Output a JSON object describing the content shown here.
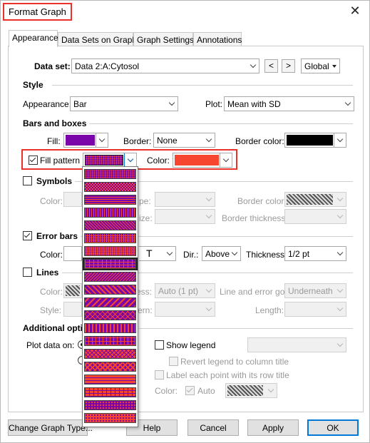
{
  "window": {
    "title": "Format Graph",
    "close_icon": "close-icon"
  },
  "tabs": [
    {
      "label": "Appearance",
      "active": true
    },
    {
      "label": "Data Sets on Graph"
    },
    {
      "label": "Graph Settings"
    },
    {
      "label": "Annotations"
    }
  ],
  "dataset": {
    "label": "Data set:",
    "value": "Data 2:A:Cytosol",
    "prev": "<",
    "next": ">",
    "scope": "Global"
  },
  "style": {
    "heading": "Style",
    "appearance_label": "Appearance:",
    "appearance_value": "Bar",
    "plot_label": "Plot:",
    "plot_value": "Mean with SD"
  },
  "bars": {
    "heading": "Bars and boxes",
    "fill_label": "Fill:",
    "fill_color": "#7a05a8",
    "border_label": "Border:",
    "border_value": "None",
    "border_color_label": "Border color:",
    "border_color": "#000000",
    "fill_pattern_label": "Fill pattern",
    "fill_pattern_checked": true,
    "color_label": "Color:",
    "pattern_color": "#f7462f"
  },
  "symbols": {
    "heading": "Symbols",
    "color_label": "Color:",
    "shape_label": "pe:",
    "size_label": "ize:",
    "border_color_label": "Border color:",
    "border_thickness_label": "Border thickness:"
  },
  "error_bars": {
    "heading": "Error bars",
    "color_label": "Color:",
    "style_value": "T",
    "dir_label": "Dir.:",
    "dir_value": "Above",
    "thickness_label": "Thickness:",
    "thickness_value": "1/2 pt"
  },
  "lines": {
    "heading": "Lines",
    "color_label": "Color:",
    "thickness_label": "ess:",
    "thickness_value": "Auto (1 pt)",
    "line_error_label": "Line and error go:",
    "line_error_value": "Underneath",
    "style_label": "Style:",
    "pattern_label": "ern:",
    "length_label": "Length:"
  },
  "additional": {
    "heading": "Additional opti",
    "plot_data_label": "Plot data on:",
    "show_legend": "Show legend",
    "revert_legend": "Revert legend to column title",
    "label_each_point": "Label each point with its row title",
    "color_label": "Color:",
    "auto_label": "Auto"
  },
  "pattern_list": {
    "accent": "#f7462f",
    "base": "#7a05a8",
    "items": [
      "fine-dots",
      "checker",
      "horiz-lines",
      "vert-lines",
      "diag-up",
      "fine-grid",
      "dense-dots",
      "brick",
      "diag-down",
      "diag-up-wide",
      "diag-down-wide",
      "diag-cross",
      "vert-wide",
      "grid-wide",
      "diamond",
      "weave",
      "horiz-wide",
      "vert-grid",
      "dots-wide",
      "dotted"
    ]
  },
  "footer": {
    "change_type": "Change Graph Type...",
    "help": "Help",
    "cancel": "Cancel",
    "apply": "Apply",
    "ok": "OK"
  }
}
